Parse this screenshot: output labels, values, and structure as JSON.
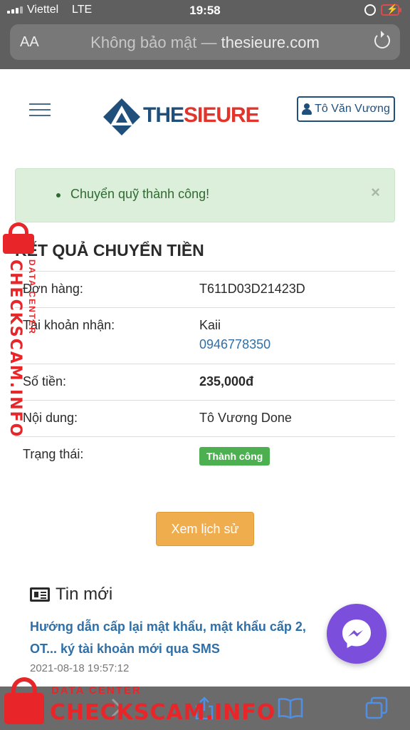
{
  "status_bar": {
    "carrier": "Viettel",
    "network": "LTE",
    "time": "19:58"
  },
  "address_bar": {
    "text_size_label": "AA",
    "security_label": "Không bảo mật",
    "separator": " — ",
    "domain": "thesieure.com"
  },
  "header": {
    "logo_the": "THE",
    "logo_sieure": "SIEURE",
    "user_name": "Tô Văn Vương"
  },
  "alert": {
    "message": "Chuyển quỹ thành công!",
    "close_label": "×"
  },
  "result": {
    "title": "KẾT QUẢ CHUYỂN TIỀN",
    "rows": [
      {
        "label": "Đơn hàng:",
        "value": "T611D03D21423D"
      },
      {
        "label": "Tài khoản nhận:",
        "value": "Kaii",
        "phone": "0946778350"
      },
      {
        "label": "Số tiền:",
        "value": "235,000đ"
      },
      {
        "label": "Nội dung:",
        "value": "Tô Vương Done"
      },
      {
        "label": "Trạng thái:",
        "value": "Thành công"
      }
    ]
  },
  "history_button": "Xem lịch sử",
  "news": {
    "heading": "Tin mới",
    "article_title": "Hướng dẫn cấp lại mật khẩu, mật khẩu cấp 2, OT... ký tài khoản mới qua SMS",
    "article_date": "2021-08-18 19:57:12"
  },
  "watermark": {
    "side_big": "CHECKSCAM.INFO",
    "side_small": "DATA CENTER",
    "bottom_small": "DATA CENTER",
    "bottom_big": "CHECKSCAM.INFO"
  },
  "colors": {
    "brand_blue": "#1f4f7a",
    "brand_red": "#e2342b",
    "success": "#4caf50",
    "warning_button": "#f0ad4e",
    "messenger": "#7b4fdc",
    "watermark": "#e8262a"
  },
  "icons": [
    "menu-icon",
    "user-icon",
    "close-icon",
    "news-icon",
    "messenger-icon",
    "back-icon",
    "forward-icon",
    "share-icon",
    "bookmarks-icon",
    "tabs-icon",
    "reload-icon"
  ]
}
